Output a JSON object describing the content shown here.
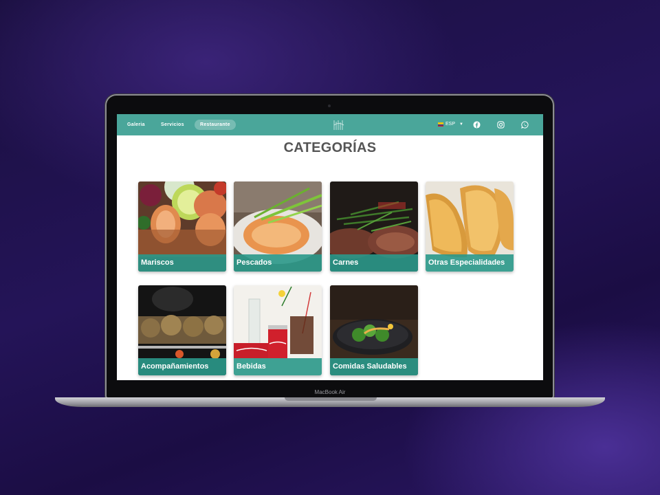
{
  "device": {
    "label": "MacBook Air"
  },
  "navbar": {
    "links": [
      {
        "label": "Galeria"
      },
      {
        "label": "Servicios"
      },
      {
        "label": "Restaurante"
      }
    ],
    "language": "ESP",
    "social_icons": [
      "facebook-icon",
      "instagram-icon",
      "whatsapp-icon"
    ]
  },
  "page": {
    "title": "CATEGORÍAS"
  },
  "categories": [
    {
      "name": "Mariscos"
    },
    {
      "name": "Pescados"
    },
    {
      "name": "Carnes"
    },
    {
      "name": "Otras Especialidades"
    },
    {
      "name": "Acompañamientos"
    },
    {
      "name": "Bebidas"
    },
    {
      "name": "Comidas Saludables"
    }
  ],
  "colors": {
    "navbar": "#4aa69a",
    "card_label": "#2a988a",
    "title": "#555555"
  }
}
